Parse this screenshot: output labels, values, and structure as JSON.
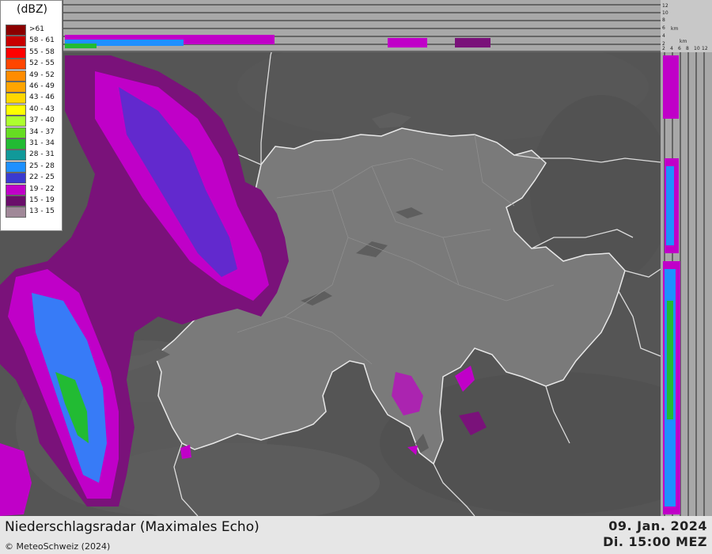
{
  "map": {
    "country": "Schweiz",
    "has_cross_sections": true
  },
  "legend": {
    "unit": "(dBZ)",
    "levels": [
      {
        "label": ">61",
        "color": "#8b0000"
      },
      {
        "label": "58 - 61",
        "color": "#c80000"
      },
      {
        "label": "55 - 58",
        "color": "#ff0000"
      },
      {
        "label": "52 - 55",
        "color": "#ff4500"
      },
      {
        "label": "49 - 52",
        "color": "#ff8c00"
      },
      {
        "label": "46 - 49",
        "color": "#ffa500"
      },
      {
        "label": "43 - 46",
        "color": "#ffd700"
      },
      {
        "label": "40 - 43",
        "color": "#ffff00"
      },
      {
        "label": "37 - 40",
        "color": "#adff2f"
      },
      {
        "label": "34 - 37",
        "color": "#66dd22"
      },
      {
        "label": "31 - 34",
        "color": "#22bb33"
      },
      {
        "label": "28 - 31",
        "color": "#119999"
      },
      {
        "label": "25 - 28",
        "color": "#1e90ff"
      },
      {
        "label": "22 - 25",
        "color": "#3a3ad0"
      },
      {
        "label": "19 - 22",
        "color": "#c000c8"
      },
      {
        "label": "15 - 19",
        "color": "#6a0e6a"
      },
      {
        "label": "13 - 15",
        "color": "#a08898"
      }
    ]
  },
  "top_profile": {
    "km_label": "km",
    "ticks": [
      "12",
      "10",
      "8",
      "6",
      "4",
      "2"
    ]
  },
  "side_profile": {
    "km_label": "km",
    "ticks": [
      "2",
      "4",
      "6",
      "8",
      "10",
      "12"
    ]
  },
  "footer": {
    "title": "Niederschlagsradar (Maximales Echo)",
    "copyright": "© MeteoSchweiz (2024)",
    "date": "09. Jan. 2024",
    "time": "Di. 15:00 MEZ"
  }
}
